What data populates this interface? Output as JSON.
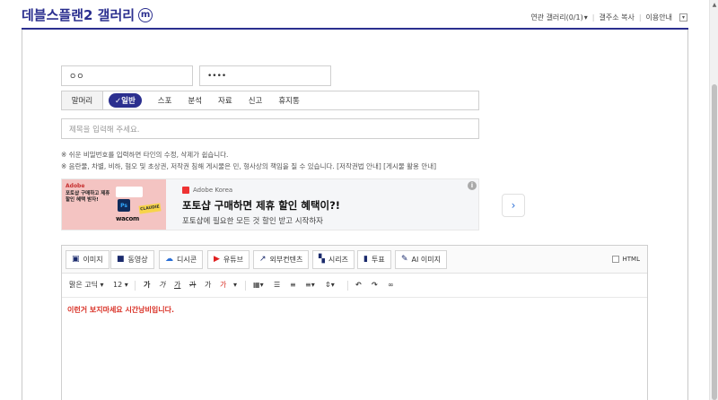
{
  "header": {
    "gallery_title": "데블스플랜2 갤러리",
    "minor_badge": "m",
    "links": {
      "related": "연관 갤러리(0/1)",
      "related_arrow": "▾",
      "copy_url": "갤주소 복사",
      "guide": "이용안내"
    },
    "menu_toggle": "▾"
  },
  "form": {
    "nickname_value": "ㅇㅇ",
    "password_value": "••••",
    "head_label": "말머리",
    "head_tabs": [
      {
        "label": "✓일반",
        "active": true
      },
      {
        "label": "스포"
      },
      {
        "label": "분석"
      },
      {
        "label": "자료"
      },
      {
        "label": "신고"
      },
      {
        "label": "휴지통"
      }
    ],
    "title_placeholder": "제목을 입력해 주세요.",
    "notice_1": "※ 쉬운 비밀번호를 입력하면 타인의 수정, 삭제가 쉽습니다.",
    "notice_2": "※ 음란물, 차별, 비하, 혐오 및 초상권, 저작권 침해 게시물은 민, 형사상의 책임을 질 수 있습니다. [저작권법 안내] [게시물 활용 안내]"
  },
  "ad": {
    "image_brand": "Adobe",
    "image_headline": "포토샵 구매하고 제휴 할인 혜택 받자!",
    "image_badge": "CLAUDIE",
    "image_product": "wacom",
    "image_ps": "Ps",
    "sponsor": "Adobe Korea",
    "title": "포토샵 구매하면 제휴 할인 혜택이?!",
    "subtitle": "포토샵에 필요한 모든 것 할인 받고 시작하자",
    "cta_arrow": "›",
    "info": "i"
  },
  "editor": {
    "toolbar": [
      {
        "label": "이미지",
        "icon": "image-icon",
        "glyph": "▣",
        "color": "#1a2a6c"
      },
      {
        "label": "동영상",
        "icon": "video-icon",
        "glyph": "■",
        "color": "#1a2a6c"
      },
      {
        "label": "디시콘",
        "icon": "dccon-icon",
        "glyph": "☁",
        "color": "#2b6fd6"
      },
      {
        "label": "유튜브",
        "icon": "youtube-icon",
        "glyph": "▶",
        "color": "#e02020"
      },
      {
        "label": "외부컨텐츠",
        "icon": "external-link-icon",
        "glyph": "↗",
        "color": "#1a2a6c"
      },
      {
        "label": "시리즈",
        "icon": "series-icon",
        "glyph": "▚",
        "color": "#1a2a6c"
      },
      {
        "label": "투표",
        "icon": "poll-icon",
        "glyph": "▮",
        "color": "#1a2a6c"
      },
      {
        "label": "AI 이미지",
        "icon": "ai-image-icon",
        "glyph": "✎",
        "color": "#1a2a6c"
      }
    ],
    "html_label": "HTML",
    "font_name": "맑은 고딕",
    "font_size": "12",
    "dropdown": "▾",
    "format_bold": "가",
    "format_italic": "가",
    "format_underline": "가",
    "format_strike": "가",
    "format_shade": "가",
    "format_color": "가",
    "body_text": "이런거 보지마세요 시간낭비입니다."
  },
  "colors": {
    "accent": "#2b2f8f",
    "body_text": "#d93025"
  }
}
